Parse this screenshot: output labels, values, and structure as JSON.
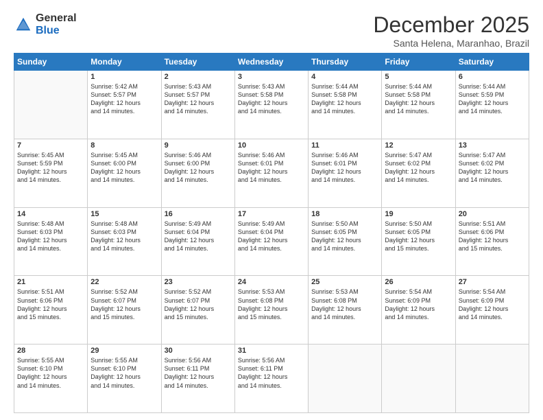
{
  "logo": {
    "general": "General",
    "blue": "Blue"
  },
  "header": {
    "month": "December 2025",
    "location": "Santa Helena, Maranhao, Brazil"
  },
  "days_of_week": [
    "Sunday",
    "Monday",
    "Tuesday",
    "Wednesday",
    "Thursday",
    "Friday",
    "Saturday"
  ],
  "weeks": [
    [
      {
        "day": "",
        "content": ""
      },
      {
        "day": "1",
        "content": "Sunrise: 5:42 AM\nSunset: 5:57 PM\nDaylight: 12 hours\nand 14 minutes."
      },
      {
        "day": "2",
        "content": "Sunrise: 5:43 AM\nSunset: 5:57 PM\nDaylight: 12 hours\nand 14 minutes."
      },
      {
        "day": "3",
        "content": "Sunrise: 5:43 AM\nSunset: 5:58 PM\nDaylight: 12 hours\nand 14 minutes."
      },
      {
        "day": "4",
        "content": "Sunrise: 5:44 AM\nSunset: 5:58 PM\nDaylight: 12 hours\nand 14 minutes."
      },
      {
        "day": "5",
        "content": "Sunrise: 5:44 AM\nSunset: 5:58 PM\nDaylight: 12 hours\nand 14 minutes."
      },
      {
        "day": "6",
        "content": "Sunrise: 5:44 AM\nSunset: 5:59 PM\nDaylight: 12 hours\nand 14 minutes."
      }
    ],
    [
      {
        "day": "7",
        "content": "Sunrise: 5:45 AM\nSunset: 5:59 PM\nDaylight: 12 hours\nand 14 minutes."
      },
      {
        "day": "8",
        "content": "Sunrise: 5:45 AM\nSunset: 6:00 PM\nDaylight: 12 hours\nand 14 minutes."
      },
      {
        "day": "9",
        "content": "Sunrise: 5:46 AM\nSunset: 6:00 PM\nDaylight: 12 hours\nand 14 minutes."
      },
      {
        "day": "10",
        "content": "Sunrise: 5:46 AM\nSunset: 6:01 PM\nDaylight: 12 hours\nand 14 minutes."
      },
      {
        "day": "11",
        "content": "Sunrise: 5:46 AM\nSunset: 6:01 PM\nDaylight: 12 hours\nand 14 minutes."
      },
      {
        "day": "12",
        "content": "Sunrise: 5:47 AM\nSunset: 6:02 PM\nDaylight: 12 hours\nand 14 minutes."
      },
      {
        "day": "13",
        "content": "Sunrise: 5:47 AM\nSunset: 6:02 PM\nDaylight: 12 hours\nand 14 minutes."
      }
    ],
    [
      {
        "day": "14",
        "content": "Sunrise: 5:48 AM\nSunset: 6:03 PM\nDaylight: 12 hours\nand 14 minutes."
      },
      {
        "day": "15",
        "content": "Sunrise: 5:48 AM\nSunset: 6:03 PM\nDaylight: 12 hours\nand 14 minutes."
      },
      {
        "day": "16",
        "content": "Sunrise: 5:49 AM\nSunset: 6:04 PM\nDaylight: 12 hours\nand 14 minutes."
      },
      {
        "day": "17",
        "content": "Sunrise: 5:49 AM\nSunset: 6:04 PM\nDaylight: 12 hours\nand 14 minutes."
      },
      {
        "day": "18",
        "content": "Sunrise: 5:50 AM\nSunset: 6:05 PM\nDaylight: 12 hours\nand 14 minutes."
      },
      {
        "day": "19",
        "content": "Sunrise: 5:50 AM\nSunset: 6:05 PM\nDaylight: 12 hours\nand 15 minutes."
      },
      {
        "day": "20",
        "content": "Sunrise: 5:51 AM\nSunset: 6:06 PM\nDaylight: 12 hours\nand 15 minutes."
      }
    ],
    [
      {
        "day": "21",
        "content": "Sunrise: 5:51 AM\nSunset: 6:06 PM\nDaylight: 12 hours\nand 15 minutes."
      },
      {
        "day": "22",
        "content": "Sunrise: 5:52 AM\nSunset: 6:07 PM\nDaylight: 12 hours\nand 15 minutes."
      },
      {
        "day": "23",
        "content": "Sunrise: 5:52 AM\nSunset: 6:07 PM\nDaylight: 12 hours\nand 15 minutes."
      },
      {
        "day": "24",
        "content": "Sunrise: 5:53 AM\nSunset: 6:08 PM\nDaylight: 12 hours\nand 15 minutes."
      },
      {
        "day": "25",
        "content": "Sunrise: 5:53 AM\nSunset: 6:08 PM\nDaylight: 12 hours\nand 14 minutes."
      },
      {
        "day": "26",
        "content": "Sunrise: 5:54 AM\nSunset: 6:09 PM\nDaylight: 12 hours\nand 14 minutes."
      },
      {
        "day": "27",
        "content": "Sunrise: 5:54 AM\nSunset: 6:09 PM\nDaylight: 12 hours\nand 14 minutes."
      }
    ],
    [
      {
        "day": "28",
        "content": "Sunrise: 5:55 AM\nSunset: 6:10 PM\nDaylight: 12 hours\nand 14 minutes."
      },
      {
        "day": "29",
        "content": "Sunrise: 5:55 AM\nSunset: 6:10 PM\nDaylight: 12 hours\nand 14 minutes."
      },
      {
        "day": "30",
        "content": "Sunrise: 5:56 AM\nSunset: 6:11 PM\nDaylight: 12 hours\nand 14 minutes."
      },
      {
        "day": "31",
        "content": "Sunrise: 5:56 AM\nSunset: 6:11 PM\nDaylight: 12 hours\nand 14 minutes."
      },
      {
        "day": "",
        "content": ""
      },
      {
        "day": "",
        "content": ""
      },
      {
        "day": "",
        "content": ""
      }
    ]
  ]
}
